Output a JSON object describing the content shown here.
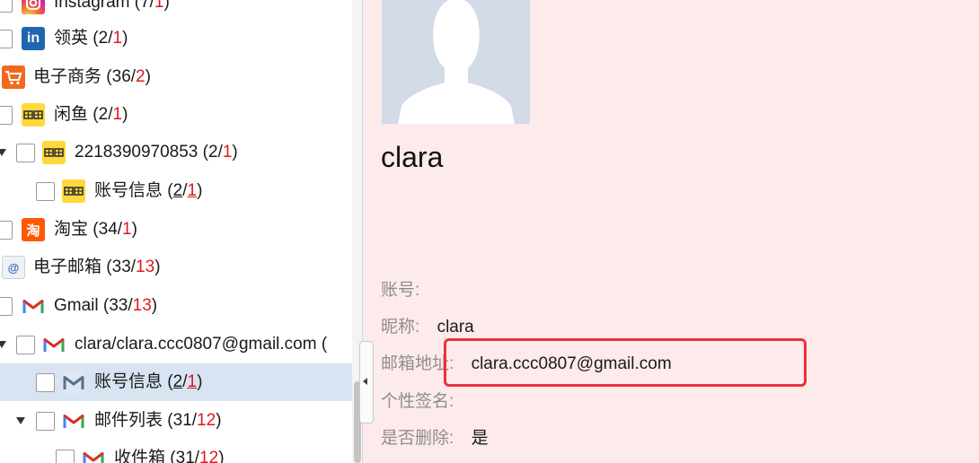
{
  "tree": {
    "rows": [
      {
        "name": "Instagram",
        "total": "7",
        "unread": "1"
      },
      {
        "name": "领英",
        "total": "2",
        "unread": "1"
      },
      {
        "name": "电子商务",
        "total": "36",
        "unread": "2"
      },
      {
        "name": "闲鱼",
        "total": "2",
        "unread": "1"
      },
      {
        "name": "2218390970853",
        "total": "2",
        "unread": "1"
      },
      {
        "name": "账号信息",
        "total": "2",
        "unread": "1"
      },
      {
        "name": "淘宝",
        "total": "34",
        "unread": "1"
      },
      {
        "name": "电子邮箱",
        "total": "33",
        "unread": "13"
      },
      {
        "name": "Gmail",
        "total": "33",
        "unread": "13"
      },
      {
        "name": "clara/clara.ccc0807@gmail.com",
        "trail": "("
      },
      {
        "name": "账号信息",
        "total": "2",
        "unread": "1"
      },
      {
        "name": "邮件列表",
        "total": "31",
        "unread": "12"
      },
      {
        "name": "收件箱",
        "total": "31",
        "unread": "12"
      }
    ],
    "icons": {
      "linkedin_text": "in",
      "taobao_text": "淘",
      "mail_text": "@"
    }
  },
  "detail": {
    "name": "clara",
    "fields": {
      "account_label": "账号:",
      "account_value": "",
      "nickname_label": "昵称:",
      "nickname_value": "clara",
      "email_label": "邮箱地址:",
      "email_value": "clara.ccc0807@gmail.com",
      "signature_label": "个性签名:",
      "signature_value": "",
      "deleted_label": "是否删除:",
      "deleted_value": "是"
    }
  },
  "colors": {
    "detail_background": "#fdeaea",
    "selected_row": "#d9e4f2",
    "unread_count": "#e0181e",
    "highlight_box": "#e8323a"
  }
}
